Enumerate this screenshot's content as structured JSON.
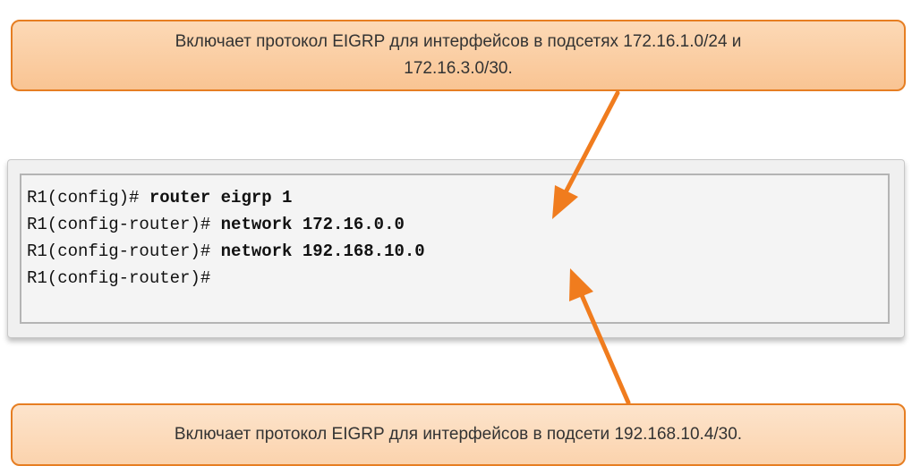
{
  "colors": {
    "callout_fill_top": "#fcd5b0",
    "callout_fill_bottom": "#fde3c8",
    "callout_border": "#e67e22",
    "arrow": "#f07c1e"
  },
  "callouts": {
    "top_line1": "Включает протокол EIGRP для интерфейсов в подсетях 172.16.1.0/24 и",
    "top_line2": "172.16.3.0/30.",
    "bottom": "Включает протокол EIGRP для интерфейсов в подсети 192.168.10.4/30."
  },
  "console": {
    "lines": [
      {
        "prompt": "R1(config)# ",
        "command": "router eigrp 1"
      },
      {
        "prompt": "R1(config-router)# ",
        "command": "network 172.16.0.0"
      },
      {
        "prompt": "R1(config-router)# ",
        "command": "network 192.168.10.0"
      },
      {
        "prompt": "R1(config-router)#",
        "command": ""
      }
    ]
  }
}
